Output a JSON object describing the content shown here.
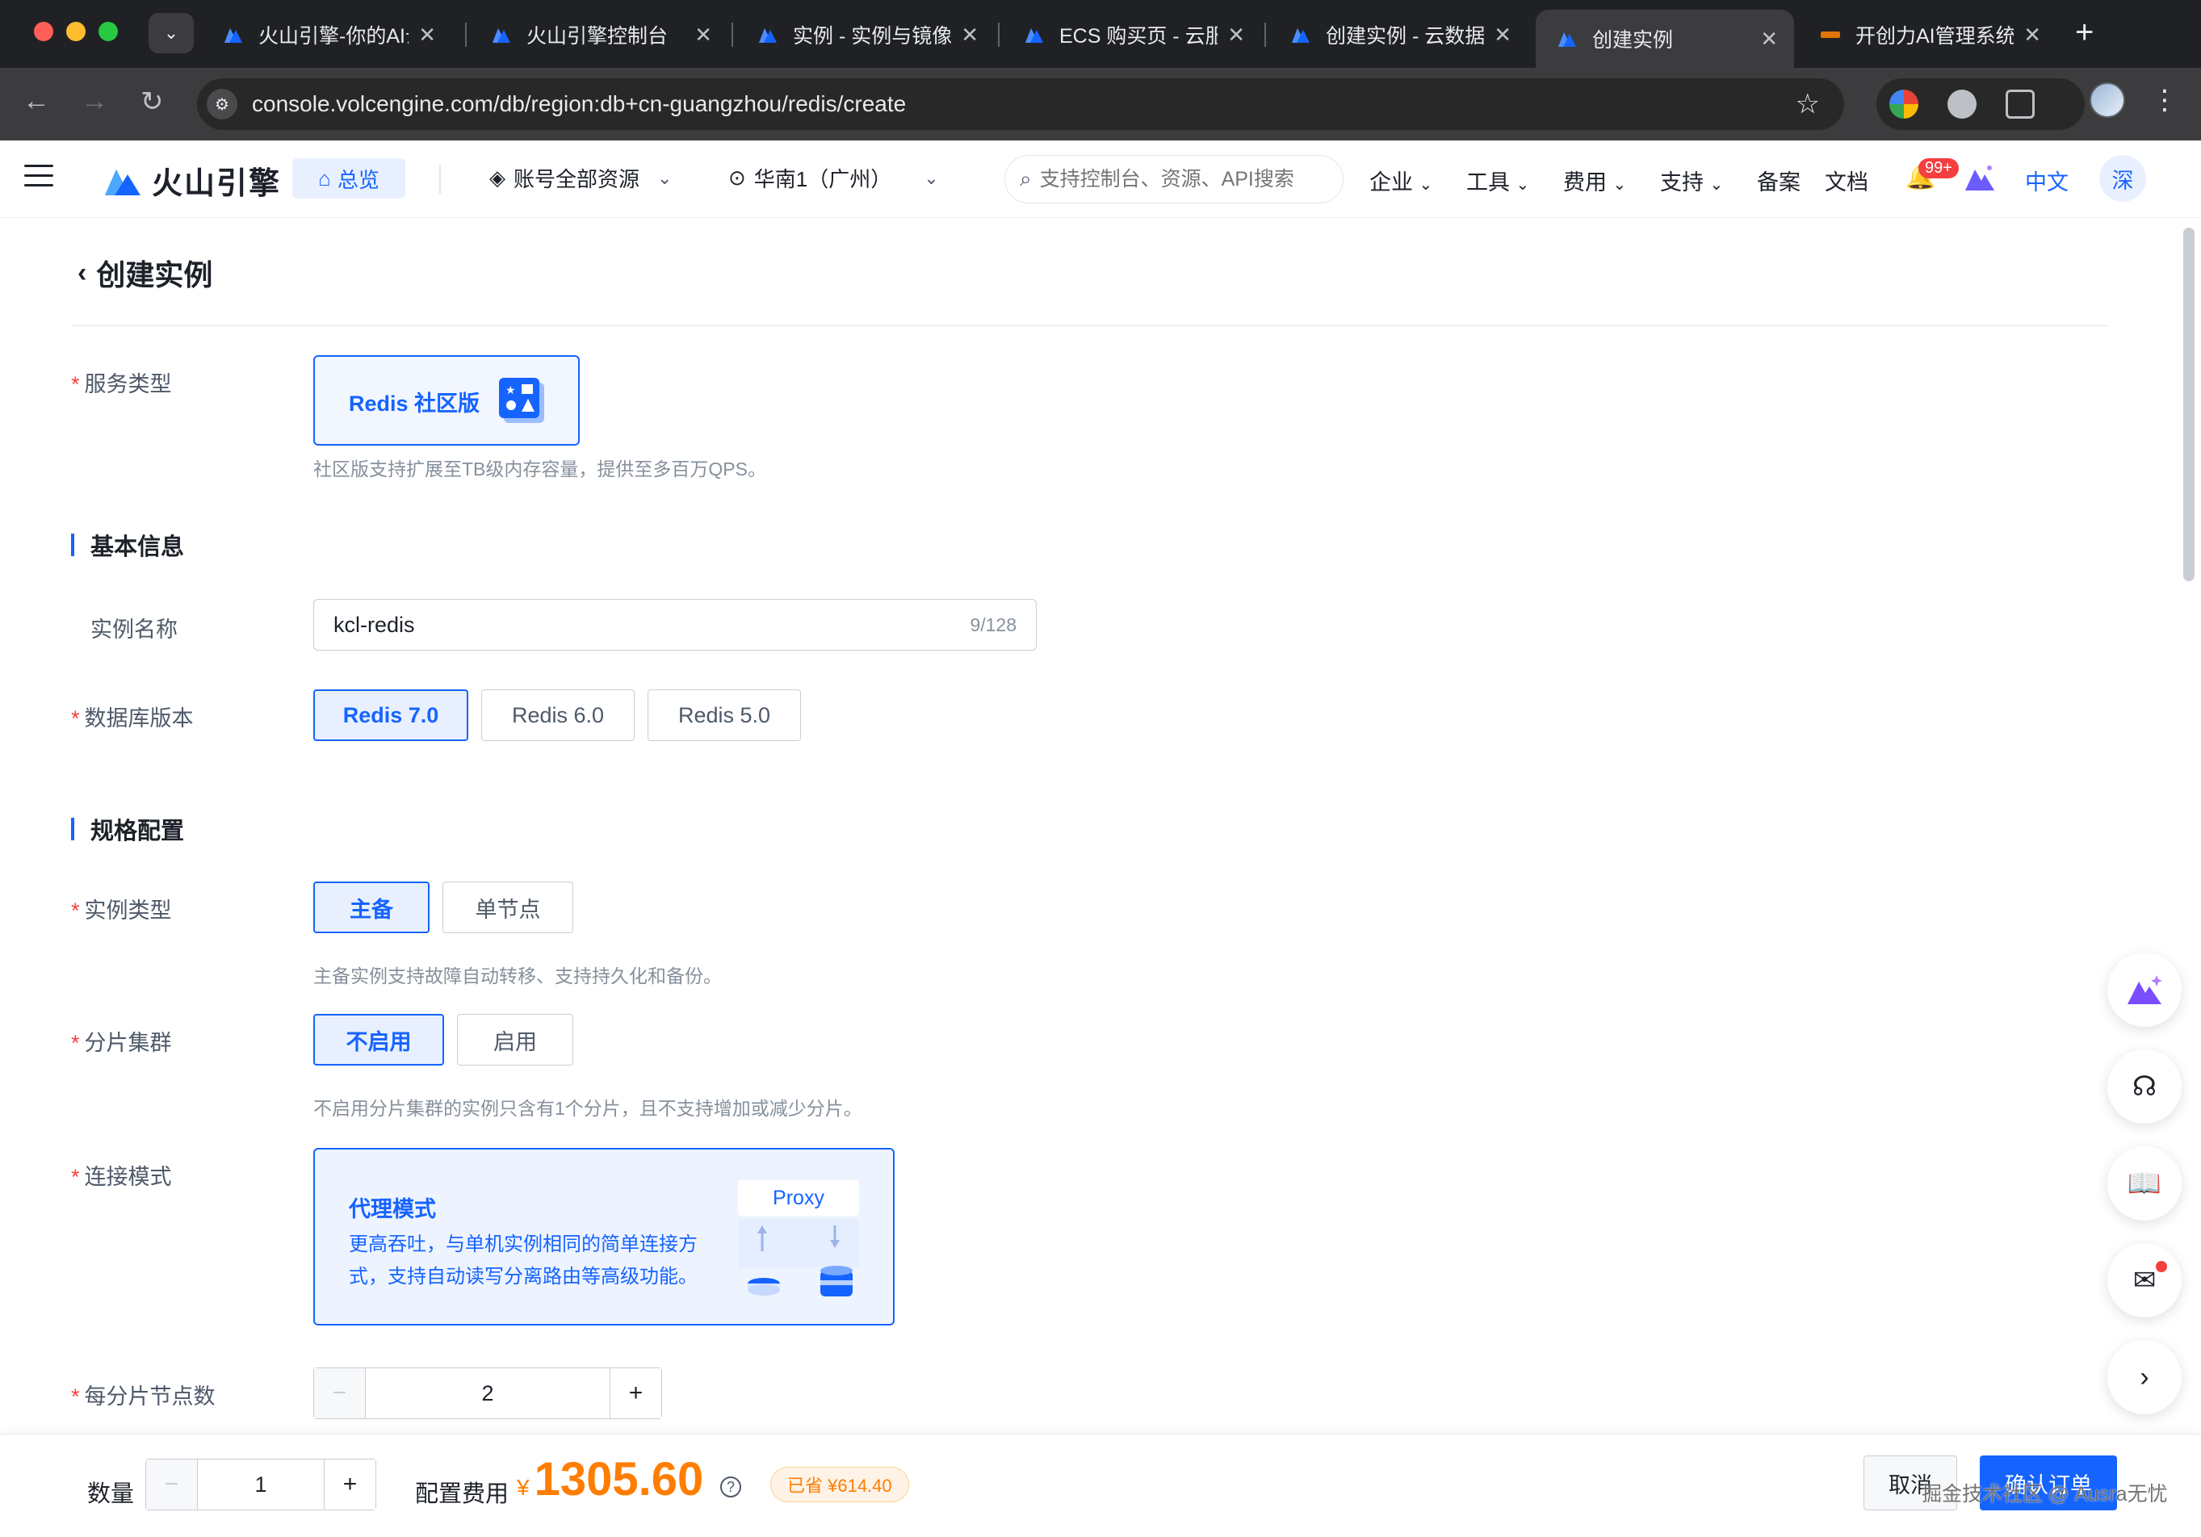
{
  "browser": {
    "tabs": [
      {
        "title": "火山引擎-你的AI云",
        "active": false
      },
      {
        "title": "火山引擎控制台",
        "active": false
      },
      {
        "title": "实例 - 实例与镜像",
        "active": false
      },
      {
        "title": "ECS 购买页 - 云服",
        "active": false
      },
      {
        "title": "创建实例 - 云数据",
        "active": false
      },
      {
        "title": "创建实例",
        "active": true
      },
      {
        "title": "开创力AI管理系统",
        "active": false
      }
    ],
    "url": "console.volcengine.com/db/region:db+cn-guangzhou/redis/create"
  },
  "header": {
    "logo_text": "火山引擎",
    "overview": "总览",
    "resources": "账号全部资源",
    "region": "华南1（广州）",
    "search_placeholder": "支持控制台、资源、API搜索",
    "menu": [
      "企业",
      "工具",
      "费用",
      "支持"
    ],
    "links": [
      "备案",
      "文档"
    ],
    "notif_count": "99+",
    "lang": "中文",
    "avatar": "深"
  },
  "page": {
    "title": "创建实例",
    "service_type": {
      "label": "服务类型",
      "card": "Redis 社区版",
      "hint": "社区版支持扩展至TB级内存容量，提供至多百万QPS。"
    },
    "basic_section": "基本信息",
    "instance_name": {
      "label": "实例名称",
      "value": "kcl-redis",
      "count": "9/128"
    },
    "db_version": {
      "label": "数据库版本",
      "options": [
        "Redis 7.0",
        "Redis 6.0",
        "Redis 5.0"
      ],
      "selected": "Redis 7.0"
    },
    "spec_section": "规格配置",
    "instance_type": {
      "label": "实例类型",
      "options": [
        "主备",
        "单节点"
      ],
      "selected": "主备",
      "hint": "主备实例支持故障自动转移、支持持久化和备份。"
    },
    "shard": {
      "label": "分片集群",
      "options": [
        "不启用",
        "启用"
      ],
      "selected": "不启用",
      "hint": "不启用分片集群的实例只含有1个分片，且不支持增加或减少分片。"
    },
    "connect_mode": {
      "label": "连接模式",
      "title": "代理模式",
      "desc": "更高吞吐，与单机实例相同的简单连接方式，支持自动读写分离路由等高级功能。",
      "badge": "Proxy"
    },
    "nodes": {
      "label": "每分片节点数",
      "value": "2"
    }
  },
  "footer": {
    "qty_label": "数量",
    "qty": "1",
    "fee_label": "配置费用",
    "currency": "¥",
    "price": "1305.60",
    "saved": "已省 ¥614.40",
    "cancel": "取消",
    "confirm": "确认订单",
    "watermark": "掘金技术社区 @ Ausra无忧"
  }
}
